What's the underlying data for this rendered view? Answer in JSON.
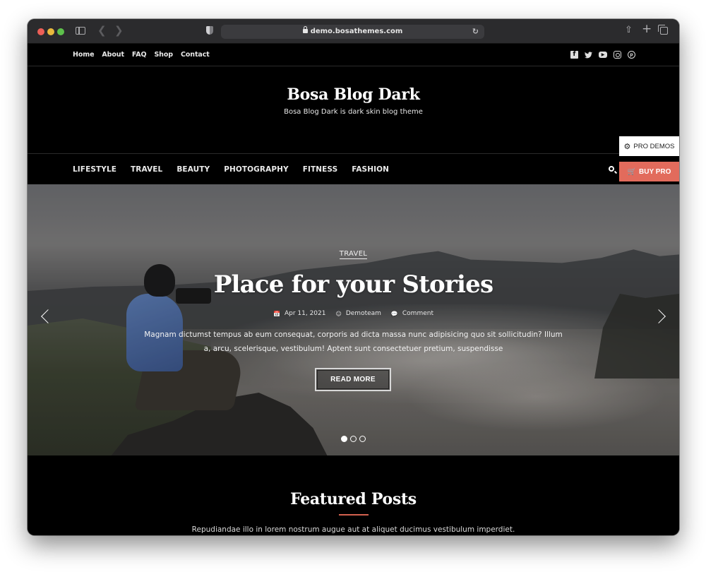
{
  "browser": {
    "url": "demo.bosathemes.com"
  },
  "topbar": {
    "menu": [
      {
        "label": "Home"
      },
      {
        "label": "About"
      },
      {
        "label": "FAQ"
      },
      {
        "label": "Shop"
      },
      {
        "label": "Contact"
      }
    ],
    "social": [
      {
        "icon": "facebook-icon",
        "glyph": "f"
      },
      {
        "icon": "twitter-icon",
        "glyph": "🐦"
      },
      {
        "icon": "youtube-icon",
        "glyph": "▶"
      },
      {
        "icon": "instagram-icon",
        "glyph": ""
      },
      {
        "icon": "pinterest-icon",
        "glyph": "p"
      }
    ]
  },
  "branding": {
    "title": "Bosa Blog Dark",
    "tagline": "Bosa Blog Dark is dark skin blog theme"
  },
  "nav": {
    "items": [
      {
        "label": "LIFESTYLE"
      },
      {
        "label": "TRAVEL"
      },
      {
        "label": "BEAUTY"
      },
      {
        "label": "PHOTOGRAPHY"
      },
      {
        "label": "FITNESS"
      },
      {
        "label": "FASHION"
      }
    ]
  },
  "floating": {
    "pro_demos": "PRO DEMOS",
    "buy_pro": "BUY PRO",
    "buy_pro_color": "#e26b5c"
  },
  "hero": {
    "category": "TRAVEL",
    "title": "Place for your Stories",
    "date": "Apr 11, 2021",
    "author": "Demoteam",
    "comment": "Comment",
    "excerpt": "Magnam dictumst tempus ab eum consequat, corporis ad dicta massa nunc adipisicing quo sit sollicitudin? Illum a, arcu, scelerisque, vestibulum! Aptent sunt consectetuer pretium, suspendisse",
    "button": "READ MORE",
    "slides_total": 3,
    "active_slide": 1
  },
  "featured": {
    "title": "Featured Posts",
    "subtitle": "Repudiandae illo in lorem nostrum augue aut at aliquet ducimus vestibulum imperdiet.",
    "accent": "#d3614f"
  }
}
